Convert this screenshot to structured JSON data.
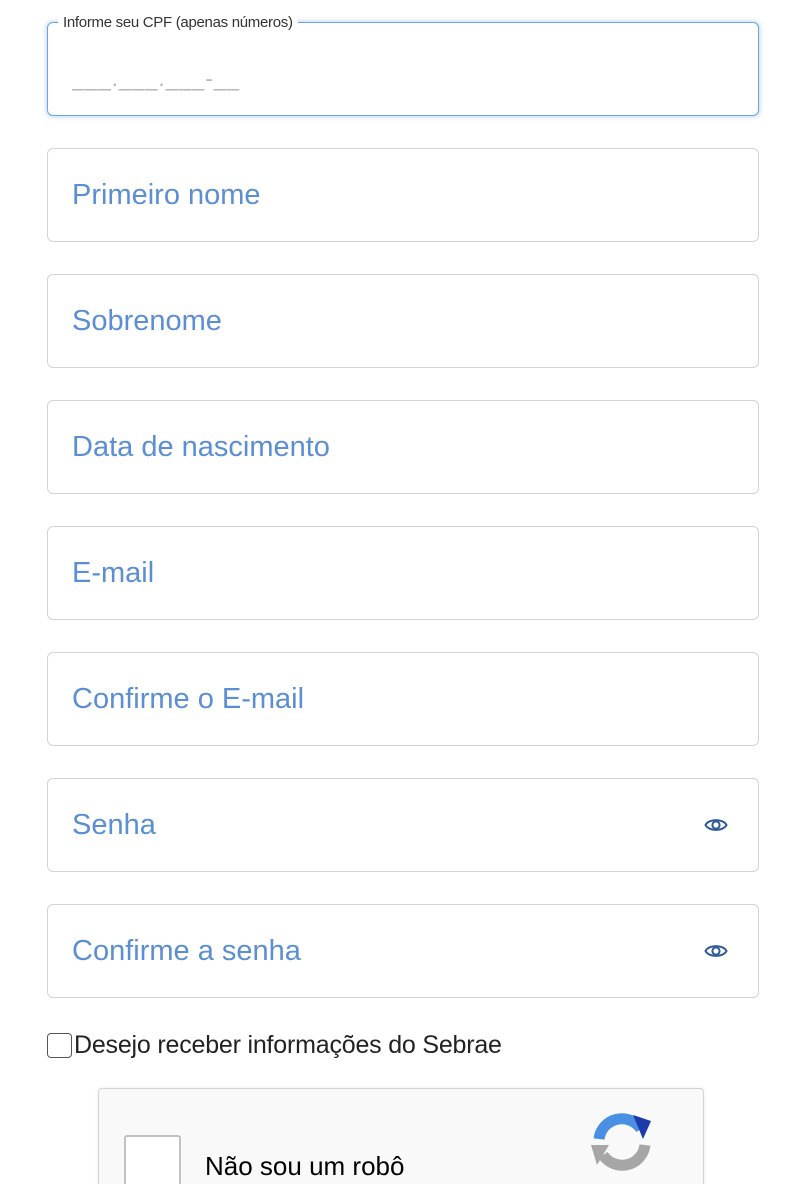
{
  "form": {
    "cpf": {
      "legend": "Informe seu CPF (apenas números)",
      "placeholder": "___.___.___-__",
      "value": ""
    },
    "first_name": {
      "placeholder": "Primeiro nome",
      "value": ""
    },
    "last_name": {
      "placeholder": "Sobrenome",
      "value": ""
    },
    "birth_date": {
      "placeholder": "Data de nascimento",
      "value": ""
    },
    "email": {
      "placeholder": "E-mail",
      "value": ""
    },
    "email_confirm": {
      "placeholder": "Confirme o E-mail",
      "value": ""
    },
    "password": {
      "placeholder": "Senha",
      "value": "",
      "toggle_icon": "eye-icon"
    },
    "password_confirm": {
      "placeholder": "Confirme a senha",
      "value": "",
      "toggle_icon": "eye-icon"
    },
    "newsletter": {
      "label": "Desejo receber informações do Sebrae",
      "checked": false
    }
  },
  "recaptcha": {
    "label": "Não sou um robô",
    "checked": false,
    "icon": "recaptcha-logo-icon"
  },
  "colors": {
    "placeholder": "#5b8ed2",
    "focus_border": "#6ea6e0",
    "border": "#d4d4d4",
    "icon": "#2f5a9a"
  }
}
